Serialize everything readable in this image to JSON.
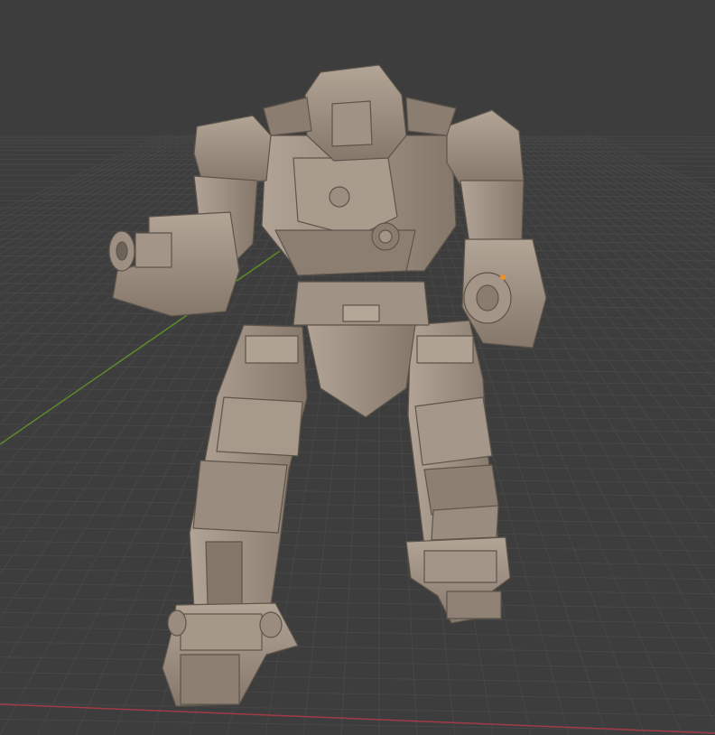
{
  "viewport": {
    "description_visible_text": "",
    "background_color": "#3d3d3d",
    "grid_minor_color": "#474747",
    "grid_major_color": "#525252",
    "x_axis_color": "#a33a47",
    "y_axis_color": "#5e8a2a",
    "model_base_color": "#9a8c7e",
    "model_light_color": "#b4a697",
    "model_shadow_color": "#6e6358",
    "selection_origin_color": "#f0902a"
  },
  "model": {
    "name_visible": "",
    "parts": [
      "head",
      "torso",
      "left-shoulder",
      "right-shoulder",
      "left-arm-cannon",
      "right-arm-weapon",
      "waist",
      "left-leg",
      "right-leg",
      "left-foot",
      "right-foot"
    ]
  }
}
